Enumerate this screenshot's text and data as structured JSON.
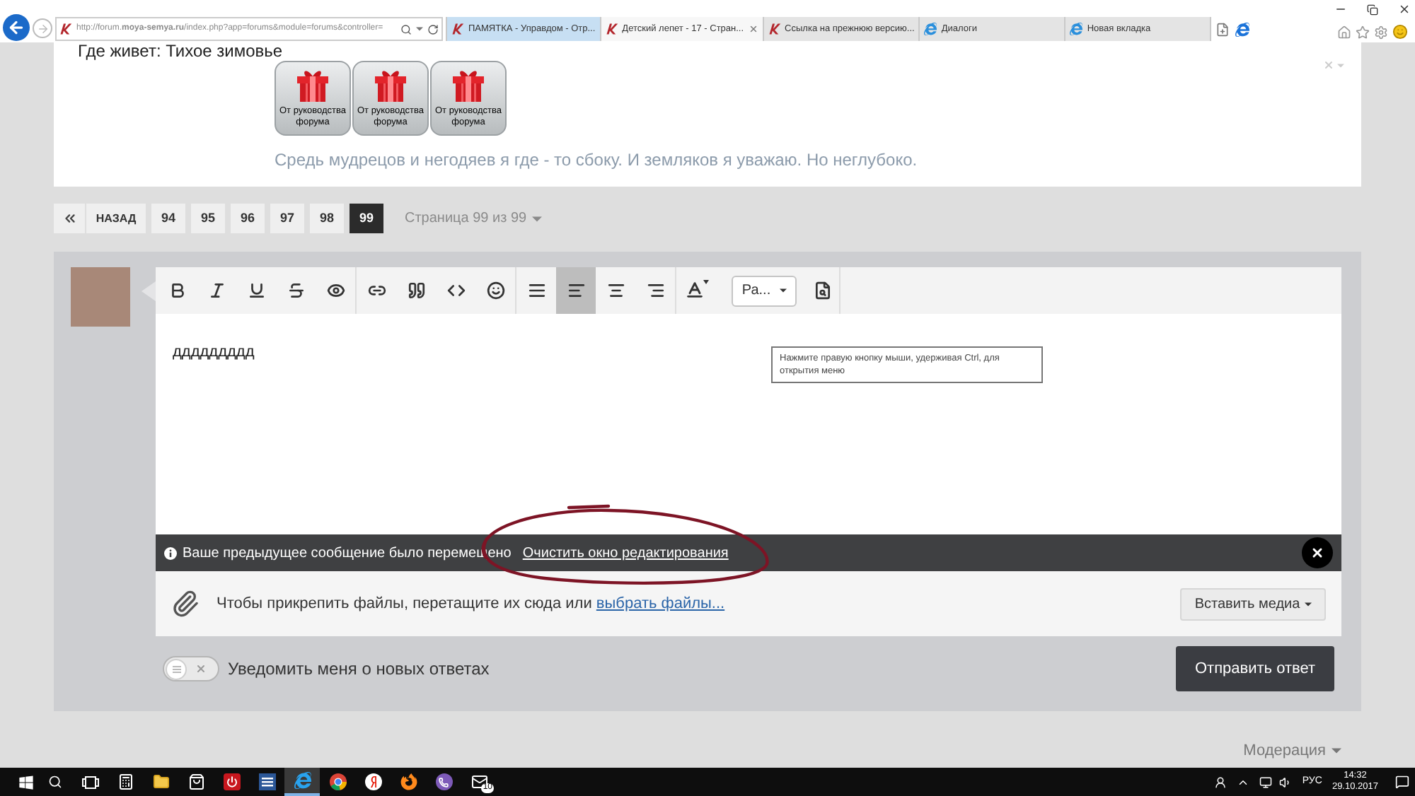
{
  "browser": {
    "address": "http://forum.**moya-semya.ru**/index.php?app=forums&module=forums&controller=",
    "tabs": [
      {
        "kind": "site",
        "title": "ПАМЯТКА - Управдом - Отр...",
        "selected": false,
        "hover": true
      },
      {
        "kind": "site",
        "title": "Детский лепет - 17 - Стран...",
        "selected": true,
        "hover": false
      },
      {
        "kind": "site",
        "title": "Ссылка на прежнюю версию...",
        "selected": false,
        "hover": false
      },
      {
        "kind": "browser",
        "title": "Диалоги",
        "selected": false,
        "hover": false
      },
      {
        "kind": "browser",
        "title": "Новая вкладка",
        "selected": false,
        "hover": false
      }
    ]
  },
  "profile": {
    "location": "Где живет: Тихое зимовье",
    "awards": [
      {
        "label": "От руководства форума"
      },
      {
        "label": "От руководства форума"
      },
      {
        "label": "От руководства форума"
      }
    ],
    "signature": "Средь мудрецов и негодяев я где - то сбоку. И земляков я уважаю. Но неглубоко."
  },
  "pagination": {
    "back": "НАЗАД",
    "pages": [
      {
        "label": "94",
        "selected": false
      },
      {
        "label": "95",
        "selected": false
      },
      {
        "label": "96",
        "selected": false
      },
      {
        "label": "97",
        "selected": false
      },
      {
        "label": "98",
        "selected": false
      },
      {
        "label": "99",
        "selected": true
      }
    ],
    "summary": "Страница 99 из 99"
  },
  "editor": {
    "toolbar": [
      {
        "buttons": [
          {
            "kind": "bold",
            "selected": false
          },
          {
            "kind": "italic",
            "selected": false
          },
          {
            "kind": "underline",
            "selected": false
          },
          {
            "kind": "strike",
            "selected": false
          },
          {
            "kind": "spoiler",
            "selected": false
          }
        ]
      },
      {
        "buttons": [
          {
            "kind": "link",
            "selected": false
          },
          {
            "kind": "quote",
            "selected": false
          },
          {
            "kind": "code",
            "selected": false
          },
          {
            "kind": "emoji",
            "selected": false
          }
        ]
      },
      {
        "buttons": [
          {
            "kind": "justify",
            "selected": false
          },
          {
            "kind": "align_left",
            "selected": true
          },
          {
            "kind": "align_center",
            "selected": false
          },
          {
            "kind": "align_right",
            "selected": false
          }
        ]
      },
      {
        "buttons": [
          {
            "kind": "font_color",
            "selected": false
          },
          {
            "kind": "font_menu",
            "label": "Ра...",
            "selected": false
          },
          {
            "kind": "preview",
            "selected": false
          }
        ]
      }
    ],
    "text": "ддддддддд",
    "tooltip": "Нажмите правую кнопку мыши, удерживая Ctrl, для открытия меню",
    "notice": {
      "message": "Ваше предыдущее сообщение было перемещено",
      "link": "Очистить окно редактирования"
    },
    "attach": {
      "hint": "Чтобы прикрепить файлы, перетащите их сюда или",
      "link": "выбрать файлы...",
      "media_button": "Вставить медиа"
    }
  },
  "notify": {
    "label": "Уведомить меня о новых ответах",
    "on": false
  },
  "submit": "Отправить ответ",
  "moderation": "Модерация",
  "taskbar": {
    "apps": [
      {
        "kind": "calculator",
        "selected": false
      },
      {
        "kind": "folder",
        "selected": false
      },
      {
        "kind": "store",
        "selected": false
      },
      {
        "kind": "power",
        "selected": false
      },
      {
        "kind": "document",
        "selected": false
      },
      {
        "kind": "e_logo",
        "selected": true
      },
      {
        "kind": "round_logo",
        "selected": false
      },
      {
        "kind": "y_logo",
        "selected": false
      },
      {
        "kind": "fox_logo",
        "selected": false
      },
      {
        "kind": "phone_bubble",
        "selected": false
      },
      {
        "kind": "mail",
        "selected": false,
        "badge": "10"
      }
    ],
    "language": "РУС",
    "time": "14:32",
    "date": "29.10.2017"
  }
}
